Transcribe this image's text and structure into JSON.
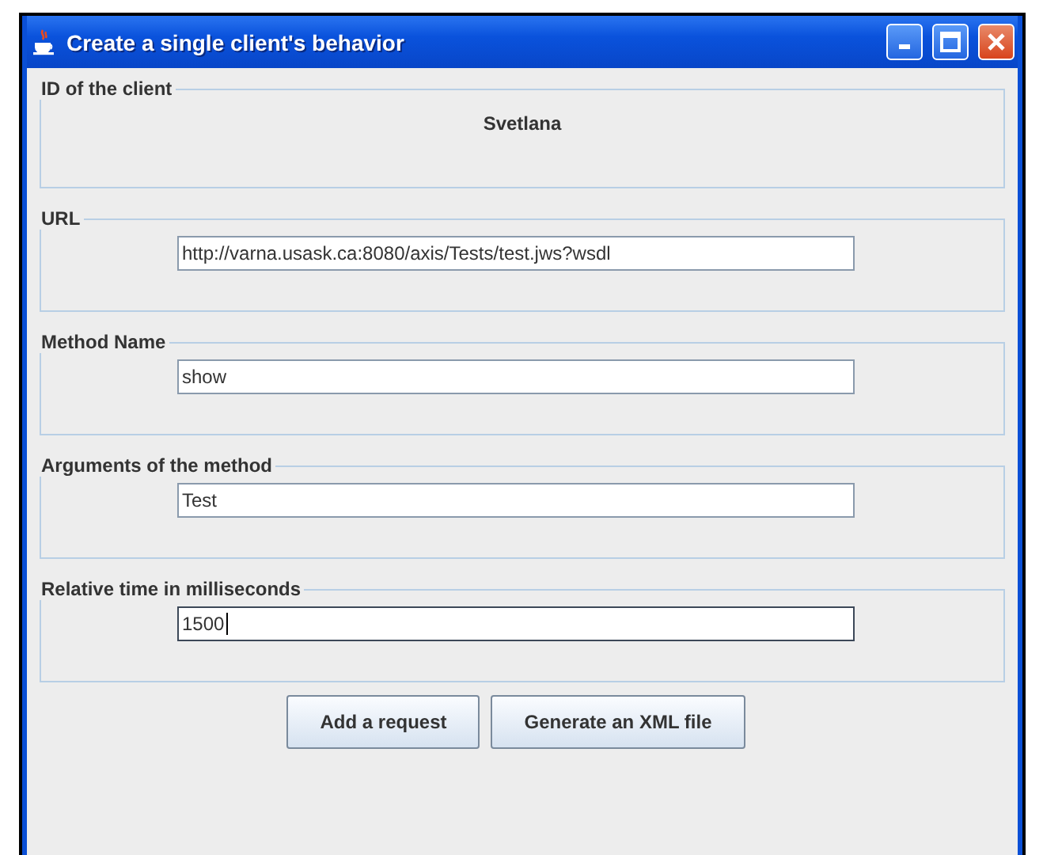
{
  "window": {
    "title": "Create a single client's behavior"
  },
  "client": {
    "legend": "ID of the client",
    "value": "Svetlana"
  },
  "fields": [
    {
      "legend": "URL",
      "value": "http://varna.usask.ca:8080/axis/Tests/test.jws?wsdl",
      "focused": false
    },
    {
      "legend": "Method Name",
      "value": "show",
      "focused": false
    },
    {
      "legend": "Arguments of the method",
      "value": "Test",
      "focused": false
    },
    {
      "legend": "Relative time in milliseconds",
      "value": "1500",
      "focused": true
    }
  ],
  "buttons": [
    "Add a request",
    "Generate an XML file"
  ]
}
